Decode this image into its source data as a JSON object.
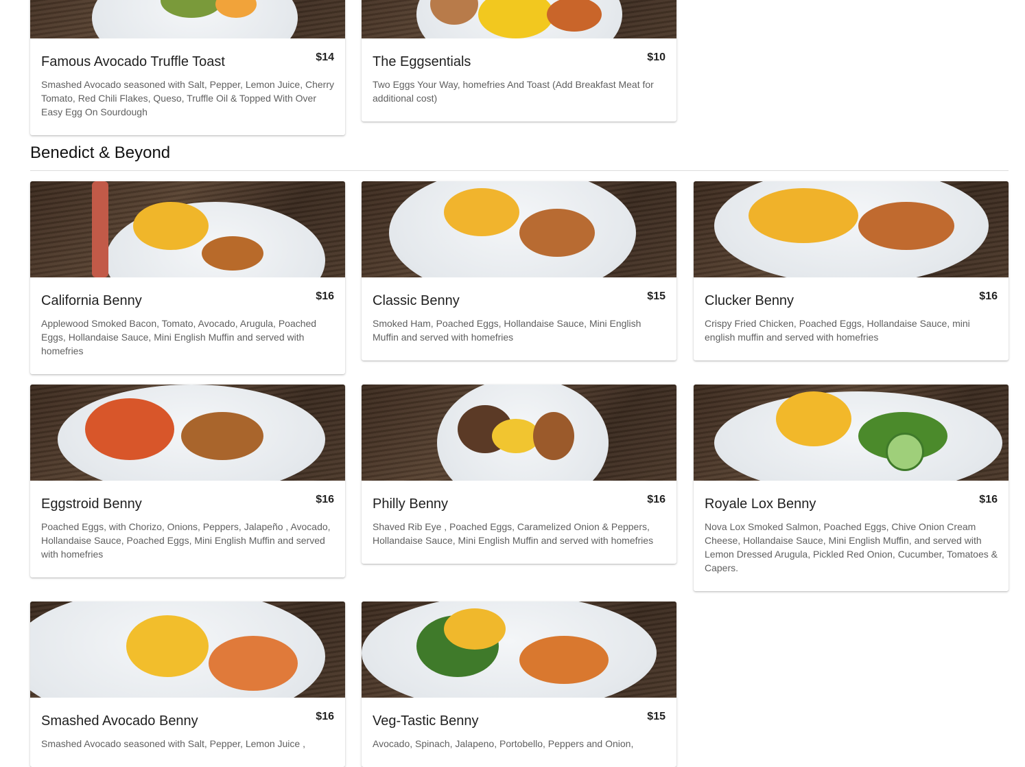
{
  "section_prev": {
    "items": [
      {
        "name": "Famous Avocado Truffle Toast",
        "price": "$14",
        "desc": "Smashed Avocado seasoned with Salt, Pepper, Lemon Juice, Cherry Tomato, Red Chili Flakes, Queso, Truffle Oil & Topped With Over Easy Egg On Sourdough"
      },
      {
        "name": "The Eggsentials",
        "price": "$10",
        "desc": "Two Eggs Your Way, homefries And Toast (Add Breakfast Meat for additional cost)"
      }
    ]
  },
  "section": {
    "title": "Benedict & Beyond",
    "items": [
      {
        "name": "California Benny",
        "price": "$16",
        "desc": "Applewood Smoked Bacon, Tomato, Avocado, Arugula, Poached Eggs, Hollandaise Sauce, Mini English Muffin and served with homefries"
      },
      {
        "name": "Classic Benny",
        "price": "$15",
        "desc": "Smoked Ham, Poached Eggs, Hollandaise Sauce, Mini English Muffin and served with homefries"
      },
      {
        "name": "Clucker Benny",
        "price": "$16",
        "desc": "Crispy Fried Chicken, Poached Eggs, Hollandaise Sauce, mini english muffin and served with homefries"
      },
      {
        "name": "Eggstroid Benny",
        "price": "$16",
        "desc": "Poached Eggs, with Chorizo, Onions, Peppers, Jalapeño , Avocado, Hollandaise Sauce, Poached Eggs, Mini English Muffin and served with homefries"
      },
      {
        "name": "Philly Benny",
        "price": "$16",
        "desc": "Shaved Rib Eye , Poached Eggs, Caramelized Onion & Peppers, Hollandaise Sauce, Mini English Muffin and served with homefries"
      },
      {
        "name": "Royale Lox Benny",
        "price": "$16",
        "desc": "Nova Lox Smoked Salmon, Poached Eggs, Chive Onion Cream Cheese, Hollandaise Sauce, Mini English Muffin, and served with Lemon Dressed Arugula, Pickled Red Onion, Cucumber, Tomatoes & Capers."
      },
      {
        "name": "Smashed Avocado Benny",
        "price": "$16",
        "desc": "Smashed Avocado seasoned with Salt, Pepper, Lemon Juice ,"
      },
      {
        "name": "Veg-Tastic Benny",
        "price": "$15",
        "desc": "Avocado, Spinach, Jalapeno, Portobello, Peppers and Onion,"
      }
    ]
  }
}
